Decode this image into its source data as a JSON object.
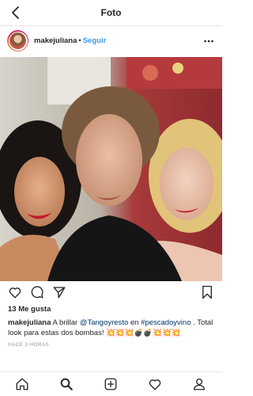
{
  "header": {
    "title": "Foto"
  },
  "post": {
    "username": "makejuliana",
    "separator": "•",
    "follow_label": "Seguir",
    "likes": "13 Me gusta",
    "caption": {
      "username": "makejuliana",
      "text_1": " A brillar ",
      "mention": "@Tangoyresto",
      "text_2": " en ",
      "hashtag": "#pescadoyvino",
      "text_3": " . Total look para estas dos bombas! 💥💥💥💣💣💥💥💥"
    },
    "timestamp": "HACE 3 HORAS"
  },
  "icons": {
    "back": "chevron-left-icon",
    "more": "more-horizontal-icon",
    "like": "heart-icon",
    "comment": "comment-icon",
    "share": "send-icon",
    "save": "bookmark-icon",
    "nav": [
      "home-icon",
      "search-icon",
      "add-icon",
      "activity-heart-icon",
      "profile-icon"
    ]
  },
  "colors": {
    "link": "#3897f0",
    "text": "#262626",
    "muted": "#999999"
  }
}
